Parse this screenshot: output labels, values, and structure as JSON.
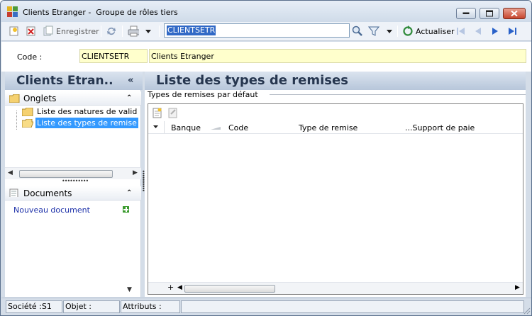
{
  "window": {
    "title": "Clients Etranger -  Groupe de rôles tiers"
  },
  "toolbar": {
    "save_label": "Enregistrer",
    "search_value": "CLIENTSETR",
    "refresh_label": "Actualiser"
  },
  "code_row": {
    "label": "Code :",
    "code_value": "CLIENTSETR",
    "description_value": "Clients Etranger"
  },
  "left_panel": {
    "title": "Clients Etran..",
    "collapse_glyph": "«",
    "tabs_section": {
      "title": "Onglets",
      "items": [
        {
          "label": "Liste des natures de valid"
        },
        {
          "label": "Liste des types de remise",
          "selected": true
        }
      ]
    },
    "documents_section": {
      "title": "Documents",
      "new_document_label": "Nouveau document"
    }
  },
  "right_panel": {
    "title": "Liste des types de remises",
    "group_label": "Types de remises par défaut",
    "grid": {
      "columns": [
        "Banque",
        "Code",
        "Type de remise",
        "...Support de paie"
      ],
      "rows": []
    }
  },
  "statusbar": {
    "societe": "Société :S1",
    "objet": "Objet :",
    "attributs": "Attributs :"
  },
  "colors": {
    "selection": "#3399ff",
    "panel_header_text": "#26364f",
    "field_bg": "#ffffcc",
    "link": "#1a2ea8"
  }
}
